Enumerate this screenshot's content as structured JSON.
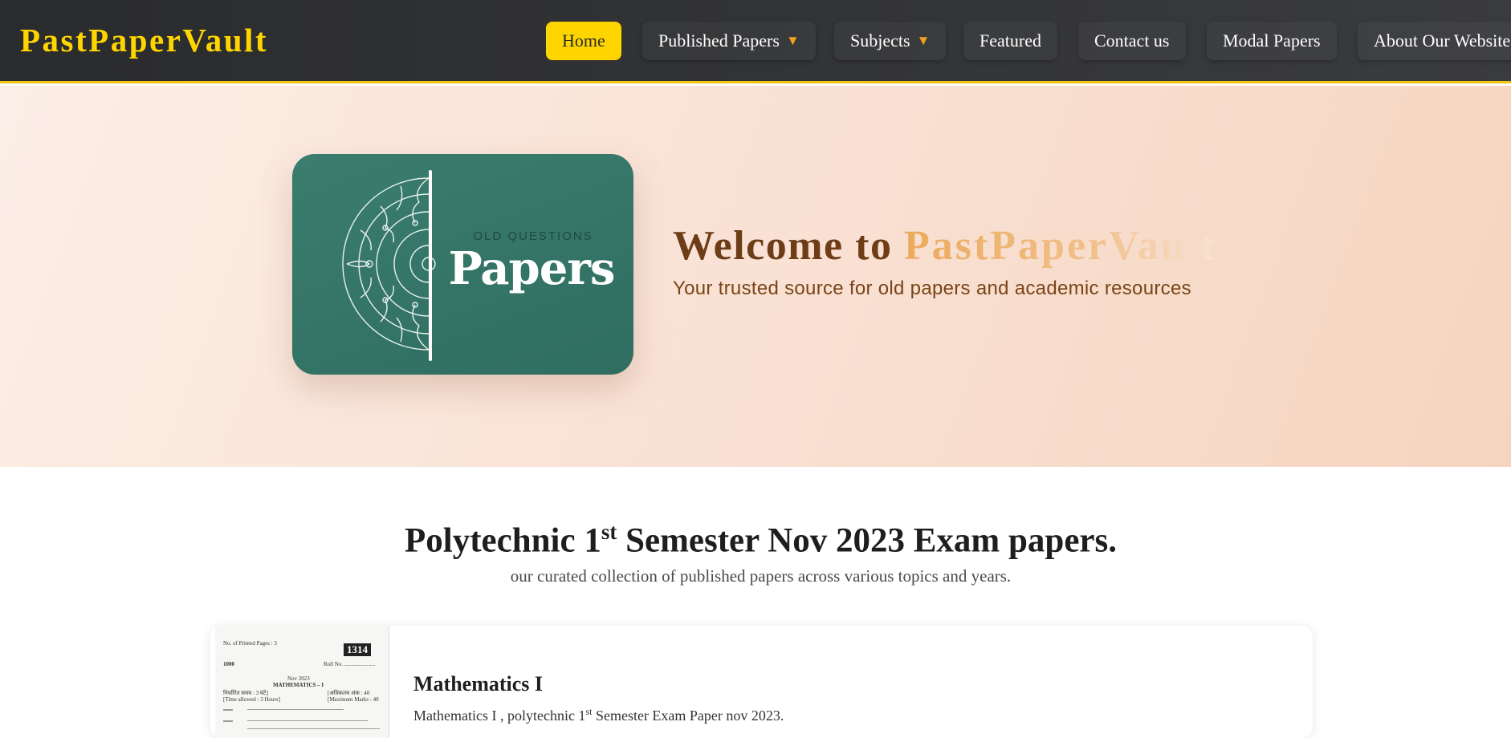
{
  "nav": {
    "brand": "PastPaperVault",
    "items": [
      {
        "label": "Home",
        "active": true,
        "dropdown": false
      },
      {
        "label": "Published Papers",
        "active": false,
        "dropdown": true
      },
      {
        "label": "Subjects",
        "active": false,
        "dropdown": true
      },
      {
        "label": "Featured",
        "active": false,
        "dropdown": false
      },
      {
        "label": "Contact us",
        "active": false,
        "dropdown": false
      },
      {
        "label": "Modal Papers",
        "active": false,
        "dropdown": false
      },
      {
        "label": "About Our Website",
        "active": false,
        "dropdown": false
      }
    ],
    "caret": "▼"
  },
  "hero": {
    "card_subtitle": "OLD QUESTIONS",
    "card_title": "Papers",
    "welcome_prefix": "Welcome to ",
    "welcome_brand": "PastPaperVault",
    "tagline": "Your trusted source for old papers and academic resources"
  },
  "section": {
    "title_prefix": "Polytechnic 1",
    "title_sup": "st",
    "title_suffix": " Semester Nov 2023 Exam papers.",
    "subtitle": "our curated collection of published papers across various topics and years."
  },
  "papers": [
    {
      "title": "Mathematics I",
      "desc_prefix": "Mathematics I , polytechnic 1",
      "desc_sup": "st",
      "desc_suffix": " Semester Exam Paper nov 2023.",
      "thumb": {
        "code": "1314",
        "header_left": "No. of Printed Pages : 3",
        "number": "1000",
        "roll": "Roll No. ......................",
        "date": "Nov 2023",
        "subject": "MATHEMATICS – I",
        "time_left": "निर्धारित समय : 3 घंटे]",
        "time_left2": "[Time allowed : 3 Hours]",
        "marks_right": "[अधिकतम अंक : 40",
        "marks_right2": "[Maximum Marks : 40"
      }
    }
  ],
  "colors": {
    "accent": "#ffd500",
    "nav_bg": "#2a2b2d",
    "hero_text": "#6d3d17",
    "card_bg": "#347463"
  }
}
